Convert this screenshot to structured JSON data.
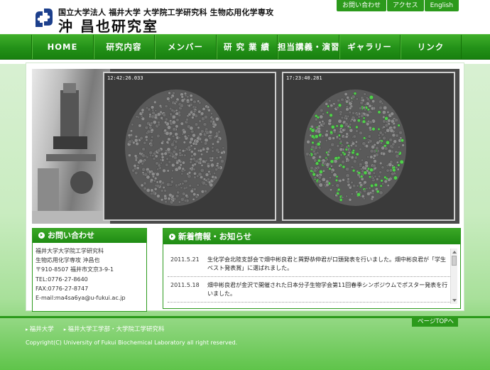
{
  "header": {
    "org_name": "国立大学法人 福井大学 大学院工学研究科 生物応用化学専攻",
    "lab_name": "沖 昌也研究室",
    "util_links": [
      "お問い合わせ",
      "アクセス",
      "English"
    ]
  },
  "nav": {
    "items": [
      "HOME",
      "研究内容",
      "メンバー",
      "研 究 業 績",
      "担当講義・演習",
      "ギャラリー",
      "リンク"
    ]
  },
  "hero": {
    "timestamp_left": "12:42:26.033",
    "timestamp_right": "17:23:40.281"
  },
  "contact": {
    "title": "お問い合わせ",
    "lines": [
      "福井大学大学院工学研究科",
      "生物応用化学専攻 沖昌也",
      "〒910-8507 福井市文京3-9-1",
      "TEL:0776-27-8640",
      "FAX:0776-27-8747",
      "E-mail:ma4sa6ya@u-fukui.ac.jp"
    ]
  },
  "news": {
    "title": "新着情報・お知らせ",
    "items": [
      {
        "date": "2011.5.21",
        "text": "生化学会北陸支部会で畑中彬良君と巽野恭伸君が口頭発表を行いました。畑中彬良君が「学生ベスト発表賞」に選ばれました。"
      },
      {
        "date": "2011.5.18",
        "text": "畑中彬良君が金沢で開催された日本分子生物学会第11回春季シンポジウムでポスター発表を行いました。"
      }
    ]
  },
  "footer": {
    "pagetop": "ページTOPへ",
    "links": [
      "福井大学",
      "福井大学工学部・大学院工学研究科"
    ],
    "copyright": "Copyright(C) University of Fukui  Biochemical Laboratory all right reserved."
  },
  "colors": {
    "brand_green": "#2c9a1c",
    "nav_green": "#239118",
    "cell_green": "#4fd04a"
  }
}
